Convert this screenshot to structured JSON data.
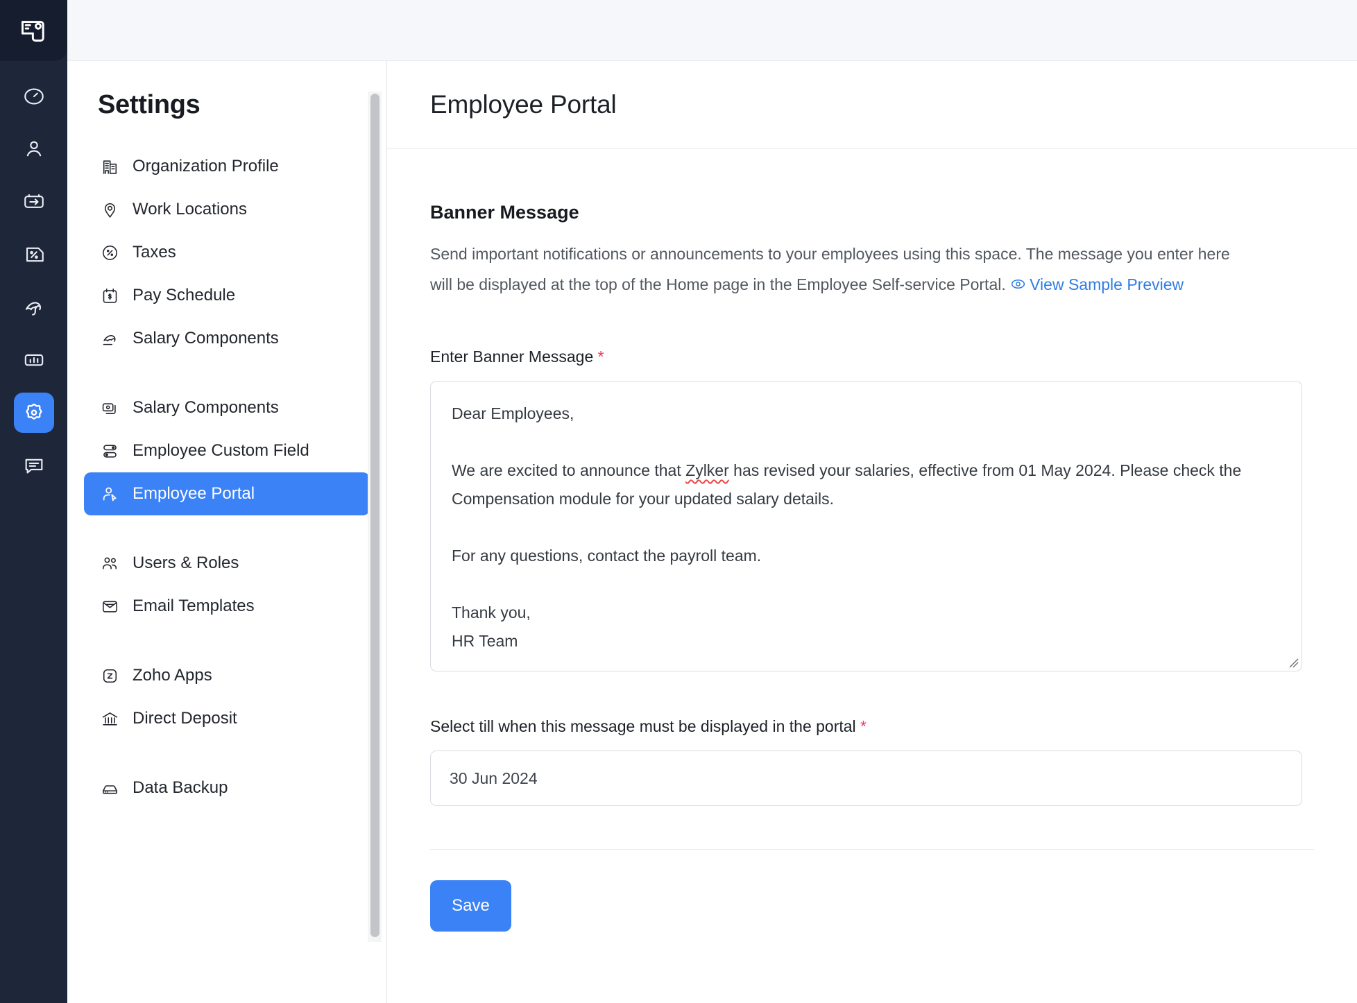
{
  "rail": {
    "logo_icon": "payroll-logo-icon",
    "items": [
      {
        "icon": "dashboard-clock-icon",
        "name": "dashboard",
        "active": false
      },
      {
        "icon": "employee-person-icon",
        "name": "employees",
        "active": false
      },
      {
        "icon": "pay-runs-arrow-icon",
        "name": "pay-runs",
        "active": false
      },
      {
        "icon": "taxes-percent-icon",
        "name": "taxes",
        "active": false
      },
      {
        "icon": "time-off-umbrella-icon",
        "name": "time-off",
        "active": false
      },
      {
        "icon": "reports-bars-icon",
        "name": "reports",
        "active": false
      },
      {
        "icon": "settings-gear-icon",
        "name": "settings",
        "active": true
      },
      {
        "icon": "chat-message-icon",
        "name": "chat",
        "active": false
      }
    ]
  },
  "settings": {
    "title": "Settings",
    "groups": [
      {
        "items": [
          {
            "label": "Organization Profile",
            "icon": "building-icon",
            "active": false
          },
          {
            "label": "Work Locations",
            "icon": "map-pin-icon",
            "active": false
          },
          {
            "label": "Taxes",
            "icon": "percent-circle-icon",
            "active": false
          },
          {
            "label": "Pay Schedule",
            "icon": "calendar-dollar-icon",
            "active": false
          },
          {
            "label": "Salary Components",
            "icon": "money-card-icon",
            "active": false
          }
        ]
      },
      {
        "items": [
          {
            "label": "Employee Custom Field",
            "icon": "toggle-list-icon",
            "active": false
          },
          {
            "label": "Employee Portal",
            "icon": "user-cursor-icon",
            "active": true
          }
        ]
      },
      {
        "items": [
          {
            "label": "Users & Roles",
            "icon": "users-icon",
            "active": false
          },
          {
            "label": "Email Templates",
            "icon": "envelope-icon",
            "active": false
          }
        ]
      },
      {
        "items": [
          {
            "label": "Zoho Apps",
            "icon": "zoho-square-icon",
            "active": false
          },
          {
            "label": "Direct Deposit",
            "icon": "bank-icon",
            "active": false
          }
        ]
      },
      {
        "items": [
          {
            "label": "Data Backup",
            "icon": "backup-drive-icon",
            "active": false
          }
        ]
      }
    ]
  },
  "page": {
    "title": "Employee Portal",
    "section_title": "Banner Message",
    "description_part1": "Send important notifications or announcements to your employees using this space. The message you enter here will be displayed at the top of the Home page in the Employee Self-service Portal. ",
    "preview_link": "View Sample Preview",
    "preview_icon": "eye-icon",
    "banner_label": "Enter Banner Message",
    "banner_required_mark": "*",
    "banner_text_line1": "Dear Employees,",
    "banner_text_line2_pre": "We are excited to announce that ",
    "banner_text_misspelled": "Zylker",
    "banner_text_line2_post": " has revised your salaries, effective from 01 May 2024. Please check the Compensation module for your updated salary details.",
    "banner_text_line3": "For any questions, contact the payroll team.",
    "banner_text_line4": "Thank you,",
    "banner_text_line5": "HR Team",
    "date_label": "Select till when this message must be displayed in the portal",
    "date_required_mark": "*",
    "date_value": "30 Jun 2024",
    "save_label": "Save"
  },
  "colors": {
    "accent": "#3b82f6",
    "rail_bg": "#1e2639",
    "link": "#2f7de1",
    "required": "#f5335b"
  }
}
